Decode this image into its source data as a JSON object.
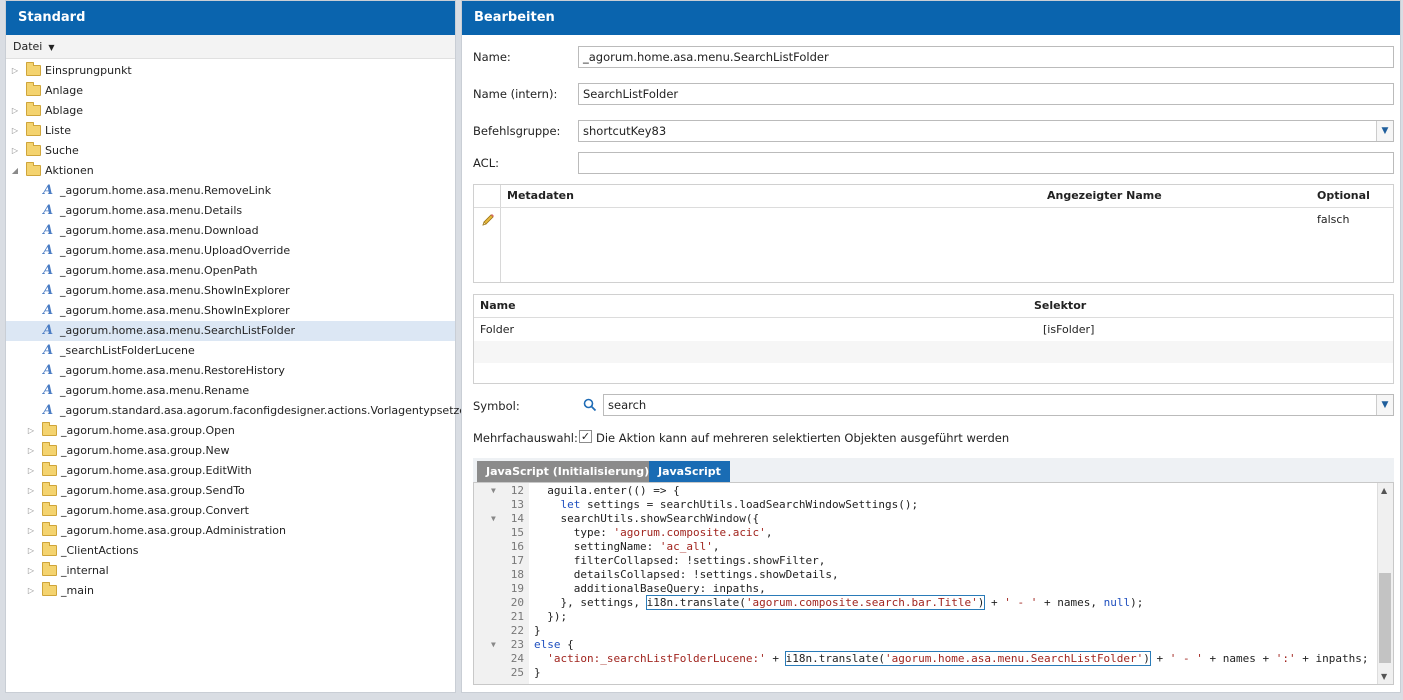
{
  "left": {
    "title": "Standard",
    "menu_file": "Datei",
    "tree": [
      {
        "label": "Einsprungpunkt",
        "type": "folder",
        "level": 0,
        "expander": "collapsed"
      },
      {
        "label": "Anlage",
        "type": "folder",
        "level": 0,
        "expander": "none"
      },
      {
        "label": "Ablage",
        "type": "folder",
        "level": 0,
        "expander": "collapsed"
      },
      {
        "label": "Liste",
        "type": "folder",
        "level": 0,
        "expander": "collapsed"
      },
      {
        "label": "Suche",
        "type": "folder",
        "level": 0,
        "expander": "collapsed"
      },
      {
        "label": "Aktionen",
        "type": "folder-open",
        "level": 0,
        "expander": "expanded"
      },
      {
        "label": "_agorum.home.asa.menu.RemoveLink",
        "type": "action",
        "level": 1
      },
      {
        "label": "_agorum.home.asa.menu.Details",
        "type": "action",
        "level": 1
      },
      {
        "label": "_agorum.home.asa.menu.Download",
        "type": "action",
        "level": 1
      },
      {
        "label": "_agorum.home.asa.menu.UploadOverride",
        "type": "action",
        "level": 1
      },
      {
        "label": "_agorum.home.asa.menu.OpenPath",
        "type": "action",
        "level": 1
      },
      {
        "label": "_agorum.home.asa.menu.ShowInExplorer",
        "type": "action",
        "level": 1
      },
      {
        "label": "_agorum.home.asa.menu.ShowInExplorer",
        "type": "action",
        "level": 1
      },
      {
        "label": "_agorum.home.asa.menu.SearchListFolder",
        "type": "action",
        "level": 1,
        "selected": true
      },
      {
        "label": "_searchListFolderLucene",
        "type": "action",
        "level": 1
      },
      {
        "label": "_agorum.home.asa.menu.RestoreHistory",
        "type": "action",
        "level": 1
      },
      {
        "label": "_agorum.home.asa.menu.Rename",
        "type": "action",
        "level": 1
      },
      {
        "label": "_agorum.standard.asa.agorum.faconfigdesigner.actions.Vorlagentypsetzenndern",
        "type": "action",
        "level": 1
      },
      {
        "label": "_agorum.home.asa.group.Open",
        "type": "folder",
        "level": 1,
        "expander": "collapsed"
      },
      {
        "label": "_agorum.home.asa.group.New",
        "type": "folder",
        "level": 1,
        "expander": "collapsed"
      },
      {
        "label": "_agorum.home.asa.group.EditWith",
        "type": "folder",
        "level": 1,
        "expander": "collapsed"
      },
      {
        "label": "_agorum.home.asa.group.SendTo",
        "type": "folder",
        "level": 1,
        "expander": "collapsed"
      },
      {
        "label": "_agorum.home.asa.group.Convert",
        "type": "folder",
        "level": 1,
        "expander": "collapsed"
      },
      {
        "label": "_agorum.home.asa.group.Administration",
        "type": "folder",
        "level": 1,
        "expander": "collapsed"
      },
      {
        "label": "_ClientActions",
        "type": "folder",
        "level": 1,
        "expander": "collapsed"
      },
      {
        "label": "_internal",
        "type": "folder",
        "level": 1,
        "expander": "collapsed"
      },
      {
        "label": "_main",
        "type": "folder",
        "level": 1,
        "expander": "collapsed"
      }
    ]
  },
  "right": {
    "title": "Bearbeiten",
    "name_label": "Name:",
    "name_value": "_agorum.home.asa.menu.SearchListFolder",
    "intern_label": "Name (intern):",
    "intern_value": "SearchListFolder",
    "group_label": "Befehlsgruppe:",
    "group_value": "shortcutKey83",
    "acl_label": "ACL:",
    "acl_value": "",
    "meta_table": {
      "headers": [
        "Metadaten",
        "Angezeigter Name",
        "Optional"
      ],
      "row": {
        "metadaten": "",
        "angezeigter_name": "",
        "optional": "falsch"
      }
    },
    "sel_table": {
      "headers": [
        "Name",
        "Selektor"
      ],
      "row": {
        "name": "Folder",
        "selektor": "[isFolder]"
      }
    },
    "symbol_label": "Symbol:",
    "symbol_value": "search",
    "multi_label": "Mehrfachauswahl:",
    "multi_checked": true,
    "multi_text": "Die Aktion kann auf mehreren selektierten Objekten ausgeführt werden",
    "tabs": [
      "JavaScript (Initialisierung)",
      "JavaScript"
    ],
    "active_tab": 1,
    "code_lines": [
      {
        "n": "12",
        "fold": true,
        "text": "  aguila.enter(() => {"
      },
      {
        "n": "13",
        "fold": false,
        "text": "    let settings = searchUtils.loadSearchWindowSettings();"
      },
      {
        "n": "14",
        "fold": true,
        "text": "    searchUtils.showSearchWindow({"
      },
      {
        "n": "15",
        "fold": false,
        "text": "      type: 'agorum.composite.acic',"
      },
      {
        "n": "16",
        "fold": false,
        "text": "      settingName: 'ac_all',"
      },
      {
        "n": "17",
        "fold": false,
        "text": "      filterCollapsed: !settings.showFilter,"
      },
      {
        "n": "18",
        "fold": false,
        "text": "      detailsCollapsed: !settings.showDetails,"
      },
      {
        "n": "19",
        "fold": false,
        "text": "      additionalBaseQuery: inpaths,"
      },
      {
        "n": "20",
        "fold": false,
        "text": "    }, settings, i18n.translate('agorum.composite.search.bar.Title') + ' - ' + names, null);"
      },
      {
        "n": "21",
        "fold": false,
        "text": "  });"
      },
      {
        "n": "22",
        "fold": false,
        "text": "}"
      },
      {
        "n": "23",
        "fold": true,
        "text": "else {"
      },
      {
        "n": "24",
        "fold": false,
        "text": "  'action:_searchListFolderLucene:' + i18n.translate('agorum.home.asa.menu.SearchListFolder') + ' - ' + names + ':' + inpaths;"
      },
      {
        "n": "25",
        "fold": false,
        "text": "}"
      }
    ]
  },
  "colors": {
    "header_blue": "#0a64ae",
    "tab_active": "#1a6cb4",
    "tab_inactive": "#8b8b8b",
    "selection": "#dce7f4"
  }
}
